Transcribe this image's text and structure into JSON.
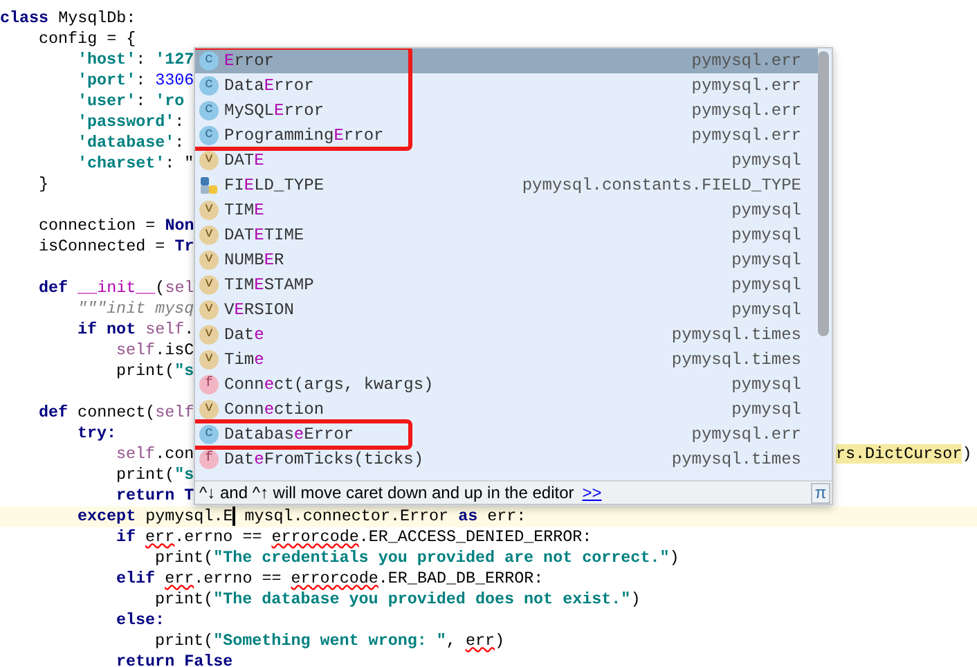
{
  "editor": {
    "lines": [
      {
        "kind": "code",
        "tokens": [
          {
            "kind": "keyword",
            "text": "class"
          },
          {
            "kind": "plain",
            "text": " MysqlDb:"
          }
        ],
        "children": [
          {
            "kind": "code",
            "tokens": [
              {
                "kind": "plain",
                "text": "config = {"
              }
            ],
            "children": [
              {
                "kind": "code",
                "tokens": [
                  {
                    "kind": "string",
                    "text": "'host'"
                  },
                  {
                    "kind": "plain",
                    "text": ": "
                  },
                  {
                    "kind": "string",
                    "text": "'127"
                  }
                ]
              },
              {
                "kind": "code",
                "tokens": [
                  {
                    "kind": "string",
                    "text": "'port'"
                  },
                  {
                    "kind": "plain",
                    "text": ": "
                  },
                  {
                    "kind": "number",
                    "text": "3306"
                  }
                ]
              },
              {
                "kind": "code",
                "tokens": [
                  {
                    "kind": "string",
                    "text": "'user'"
                  },
                  {
                    "kind": "plain",
                    "text": ": "
                  },
                  {
                    "kind": "string",
                    "text": "'ro"
                  }
                ]
              },
              {
                "kind": "code",
                "tokens": [
                  {
                    "kind": "string",
                    "text": "'password'"
                  },
                  {
                    "kind": "plain",
                    "text": ":"
                  }
                ]
              },
              {
                "kind": "code",
                "tokens": [
                  {
                    "kind": "string",
                    "text": "'database'"
                  },
                  {
                    "kind": "plain",
                    "text": ":"
                  }
                ]
              },
              {
                "kind": "code",
                "tokens": [
                  {
                    "kind": "string",
                    "text": "'charset'"
                  },
                  {
                    "kind": "plain",
                    "text": ": \""
                  }
                ]
              }
            ]
          },
          {
            "kind": "code",
            "tokens": [
              {
                "kind": "plain",
                "text": "}"
              }
            ]
          },
          {
            "kind": "blank"
          },
          {
            "kind": "code",
            "tokens": [
              {
                "kind": "plain",
                "text": "connection = "
              },
              {
                "kind": "keyword",
                "text": "Non"
              }
            ]
          },
          {
            "kind": "code",
            "tokens": [
              {
                "kind": "plain",
                "text": "isConnected = "
              },
              {
                "kind": "keyword",
                "text": "Tr"
              }
            ]
          },
          {
            "kind": "blank"
          },
          {
            "kind": "code",
            "tokens": [
              {
                "kind": "keyword",
                "text": "def "
              },
              {
                "kind": "magic",
                "text": "__init__"
              },
              {
                "kind": "plain",
                "text": "("
              },
              {
                "kind": "self",
                "text": "sel"
              }
            ],
            "children": [
              {
                "kind": "code",
                "tokens": [
                  {
                    "kind": "docstring",
                    "text": "\"\"\"init mysq"
                  }
                ]
              },
              {
                "kind": "code",
                "tokens": [
                  {
                    "kind": "keyword",
                    "text": "if not "
                  },
                  {
                    "kind": "self",
                    "text": "self"
                  },
                  {
                    "kind": "plain",
                    "text": "."
                  }
                ],
                "children": [
                  {
                    "kind": "code",
                    "tokens": [
                      {
                        "kind": "self",
                        "text": "self"
                      },
                      {
                        "kind": "plain",
                        "text": ".isC"
                      }
                    ]
                  },
                  {
                    "kind": "code",
                    "tokens": [
                      {
                        "kind": "plain",
                        "text": "print("
                      },
                      {
                        "kind": "string",
                        "text": "\"s"
                      }
                    ]
                  }
                ]
              }
            ]
          },
          {
            "kind": "blank"
          },
          {
            "kind": "code",
            "tokens": [
              {
                "kind": "keyword",
                "text": "def"
              },
              {
                "kind": "plain",
                "text": " connect("
              },
              {
                "kind": "self",
                "text": "self"
              }
            ],
            "children": [
              {
                "kind": "code",
                "tokens": [
                  {
                    "kind": "keyword",
                    "text": "try:"
                  }
                ],
                "children": [
                  {
                    "kind": "code",
                    "tokens": [
                      {
                        "kind": "self",
                        "text": "self"
                      },
                      {
                        "kind": "plain",
                        "text": ".con"
                      }
                    ],
                    "tail": [
                      {
                        "kind": "match",
                        "text": "rs.DictCursor"
                      },
                      {
                        "kind": "plain",
                        "text": ")"
                      }
                    ]
                  },
                  {
                    "kind": "code",
                    "tokens": [
                      {
                        "kind": "plain",
                        "text": "print("
                      },
                      {
                        "kind": "string",
                        "text": "\"s"
                      }
                    ]
                  },
                  {
                    "kind": "code",
                    "tokens": [
                      {
                        "kind": "keyword",
                        "text": "return T"
                      }
                    ]
                  }
                ]
              },
              {
                "kind": "code",
                "current": true,
                "tokens": [
                  {
                    "kind": "keyword",
                    "text": "except"
                  },
                  {
                    "kind": "plain",
                    "text": " pymysql.E",
                    "caret": true
                  },
                  {
                    "kind": "plain",
                    "text": " mysql.connector.Error "
                  },
                  {
                    "kind": "keyword",
                    "text": "as"
                  },
                  {
                    "kind": "plain",
                    "text": " err:"
                  }
                ],
                "children": [
                  {
                    "kind": "code",
                    "tokens": [
                      {
                        "kind": "keyword",
                        "text": "if "
                      },
                      {
                        "kind": "error",
                        "text": "err"
                      },
                      {
                        "kind": "plain",
                        "text": ".errno == "
                      },
                      {
                        "kind": "error",
                        "text": "errorcode"
                      },
                      {
                        "kind": "plain",
                        "text": ".ER_ACCESS_DENIED_ERROR:"
                      }
                    ],
                    "children": [
                      {
                        "kind": "code",
                        "tokens": [
                          {
                            "kind": "plain",
                            "text": "print("
                          },
                          {
                            "kind": "string",
                            "text": "\"The credentials you provided are not correct.\""
                          },
                          {
                            "kind": "plain",
                            "text": ")"
                          }
                        ]
                      }
                    ]
                  },
                  {
                    "kind": "code",
                    "tokens": [
                      {
                        "kind": "keyword",
                        "text": "elif "
                      },
                      {
                        "kind": "error",
                        "text": "err"
                      },
                      {
                        "kind": "plain",
                        "text": ".errno == "
                      },
                      {
                        "kind": "error",
                        "text": "errorcode"
                      },
                      {
                        "kind": "plain",
                        "text": ".ER_BAD_DB_ERROR:"
                      }
                    ],
                    "children": [
                      {
                        "kind": "code",
                        "tokens": [
                          {
                            "kind": "plain",
                            "text": "print("
                          },
                          {
                            "kind": "string",
                            "text": "\"The database you provided does not exist.\""
                          },
                          {
                            "kind": "plain",
                            "text": ")"
                          }
                        ]
                      }
                    ]
                  },
                  {
                    "kind": "code",
                    "tokens": [
                      {
                        "kind": "keyword",
                        "text": "else:"
                      }
                    ],
                    "children": [
                      {
                        "kind": "code",
                        "tokens": [
                          {
                            "kind": "plain",
                            "text": "print("
                          },
                          {
                            "kind": "string",
                            "text": "\"Something went wrong: \""
                          },
                          {
                            "kind": "plain",
                            "text": ", "
                          },
                          {
                            "kind": "error",
                            "text": "err"
                          },
                          {
                            "kind": "plain",
                            "text": ")"
                          }
                        ]
                      }
                    ]
                  },
                  {
                    "kind": "code",
                    "tokens": [
                      {
                        "kind": "keyword",
                        "text": "return False"
                      }
                    ]
                  }
                ]
              }
            ]
          }
        ]
      }
    ]
  },
  "completion": {
    "items": [
      {
        "kind": "class",
        "icon": "c",
        "match": "E",
        "after": "rror",
        "source": "pymysql.err",
        "selected": true,
        "boxed": true
      },
      {
        "kind": "class",
        "icon": "c",
        "before": "Data",
        "match": "E",
        "after": "rror",
        "source": "pymysql.err",
        "selected": false,
        "boxed": true
      },
      {
        "kind": "class",
        "icon": "c",
        "before": "MySQL",
        "match": "E",
        "after": "rror",
        "source": "pymysql.err",
        "selected": false,
        "boxed": true
      },
      {
        "kind": "class",
        "icon": "c",
        "before": "Programming",
        "match": "E",
        "after": "rror",
        "source": "pymysql.err",
        "selected": false,
        "boxed": true
      },
      {
        "kind": "variable",
        "icon": "v",
        "before": "DAT",
        "match": "E",
        "source": "pymysql",
        "selected": false,
        "boxed": false
      },
      {
        "kind": "module",
        "before": "FI",
        "match": "E",
        "after": "LD_TYPE",
        "source": "pymysql.constants.FIELD_TYPE",
        "selected": false,
        "boxed": false
      },
      {
        "kind": "variable",
        "icon": "v",
        "before": "TIM",
        "match": "E",
        "source": "pymysql",
        "selected": false,
        "boxed": false
      },
      {
        "kind": "variable",
        "icon": "v",
        "before": "DAT",
        "match": "E",
        "after": "TIME",
        "source": "pymysql",
        "selected": false,
        "boxed": false
      },
      {
        "kind": "variable",
        "icon": "v",
        "before": "NUMB",
        "match": "E",
        "after": "R",
        "source": "pymysql",
        "selected": false,
        "boxed": false
      },
      {
        "kind": "variable",
        "icon": "v",
        "before": "TIM",
        "match": "E",
        "after": "STAMP",
        "source": "pymysql",
        "selected": false,
        "boxed": false
      },
      {
        "kind": "variable",
        "icon": "v",
        "before": "V",
        "match": "E",
        "after": "RSION",
        "source": "pymysql",
        "selected": false,
        "boxed": false
      },
      {
        "kind": "variable",
        "icon": "v",
        "before": "Dat",
        "match": "e",
        "source": "pymysql.times",
        "selected": false,
        "boxed": false
      },
      {
        "kind": "variable",
        "icon": "v",
        "before": "Tim",
        "match": "e",
        "source": "pymysql.times",
        "selected": false,
        "boxed": false
      },
      {
        "kind": "function",
        "icon": "f",
        "before": "Conn",
        "match": "e",
        "after": "ct(args, kwargs)",
        "source": "pymysql",
        "selected": false,
        "boxed": false
      },
      {
        "kind": "variable",
        "icon": "v",
        "before": "Conn",
        "match": "e",
        "after": "ction",
        "source": "pymysql",
        "selected": false,
        "boxed": false
      },
      {
        "kind": "class",
        "icon": "c",
        "before": "Databas",
        "match": "e",
        "after": "Error",
        "source": "pymysql.err",
        "selected": false,
        "boxed": true
      },
      {
        "kind": "function",
        "icon": "f",
        "before": "Dat",
        "match": "e",
        "after": "FromTicks(ticks)",
        "source": "pymysql.times",
        "selected": false,
        "boxed": false
      }
    ],
    "hint": "^↓ and ^↑ will move caret down and up in the editor",
    "hint_link": ">>",
    "pi_button": "π"
  }
}
